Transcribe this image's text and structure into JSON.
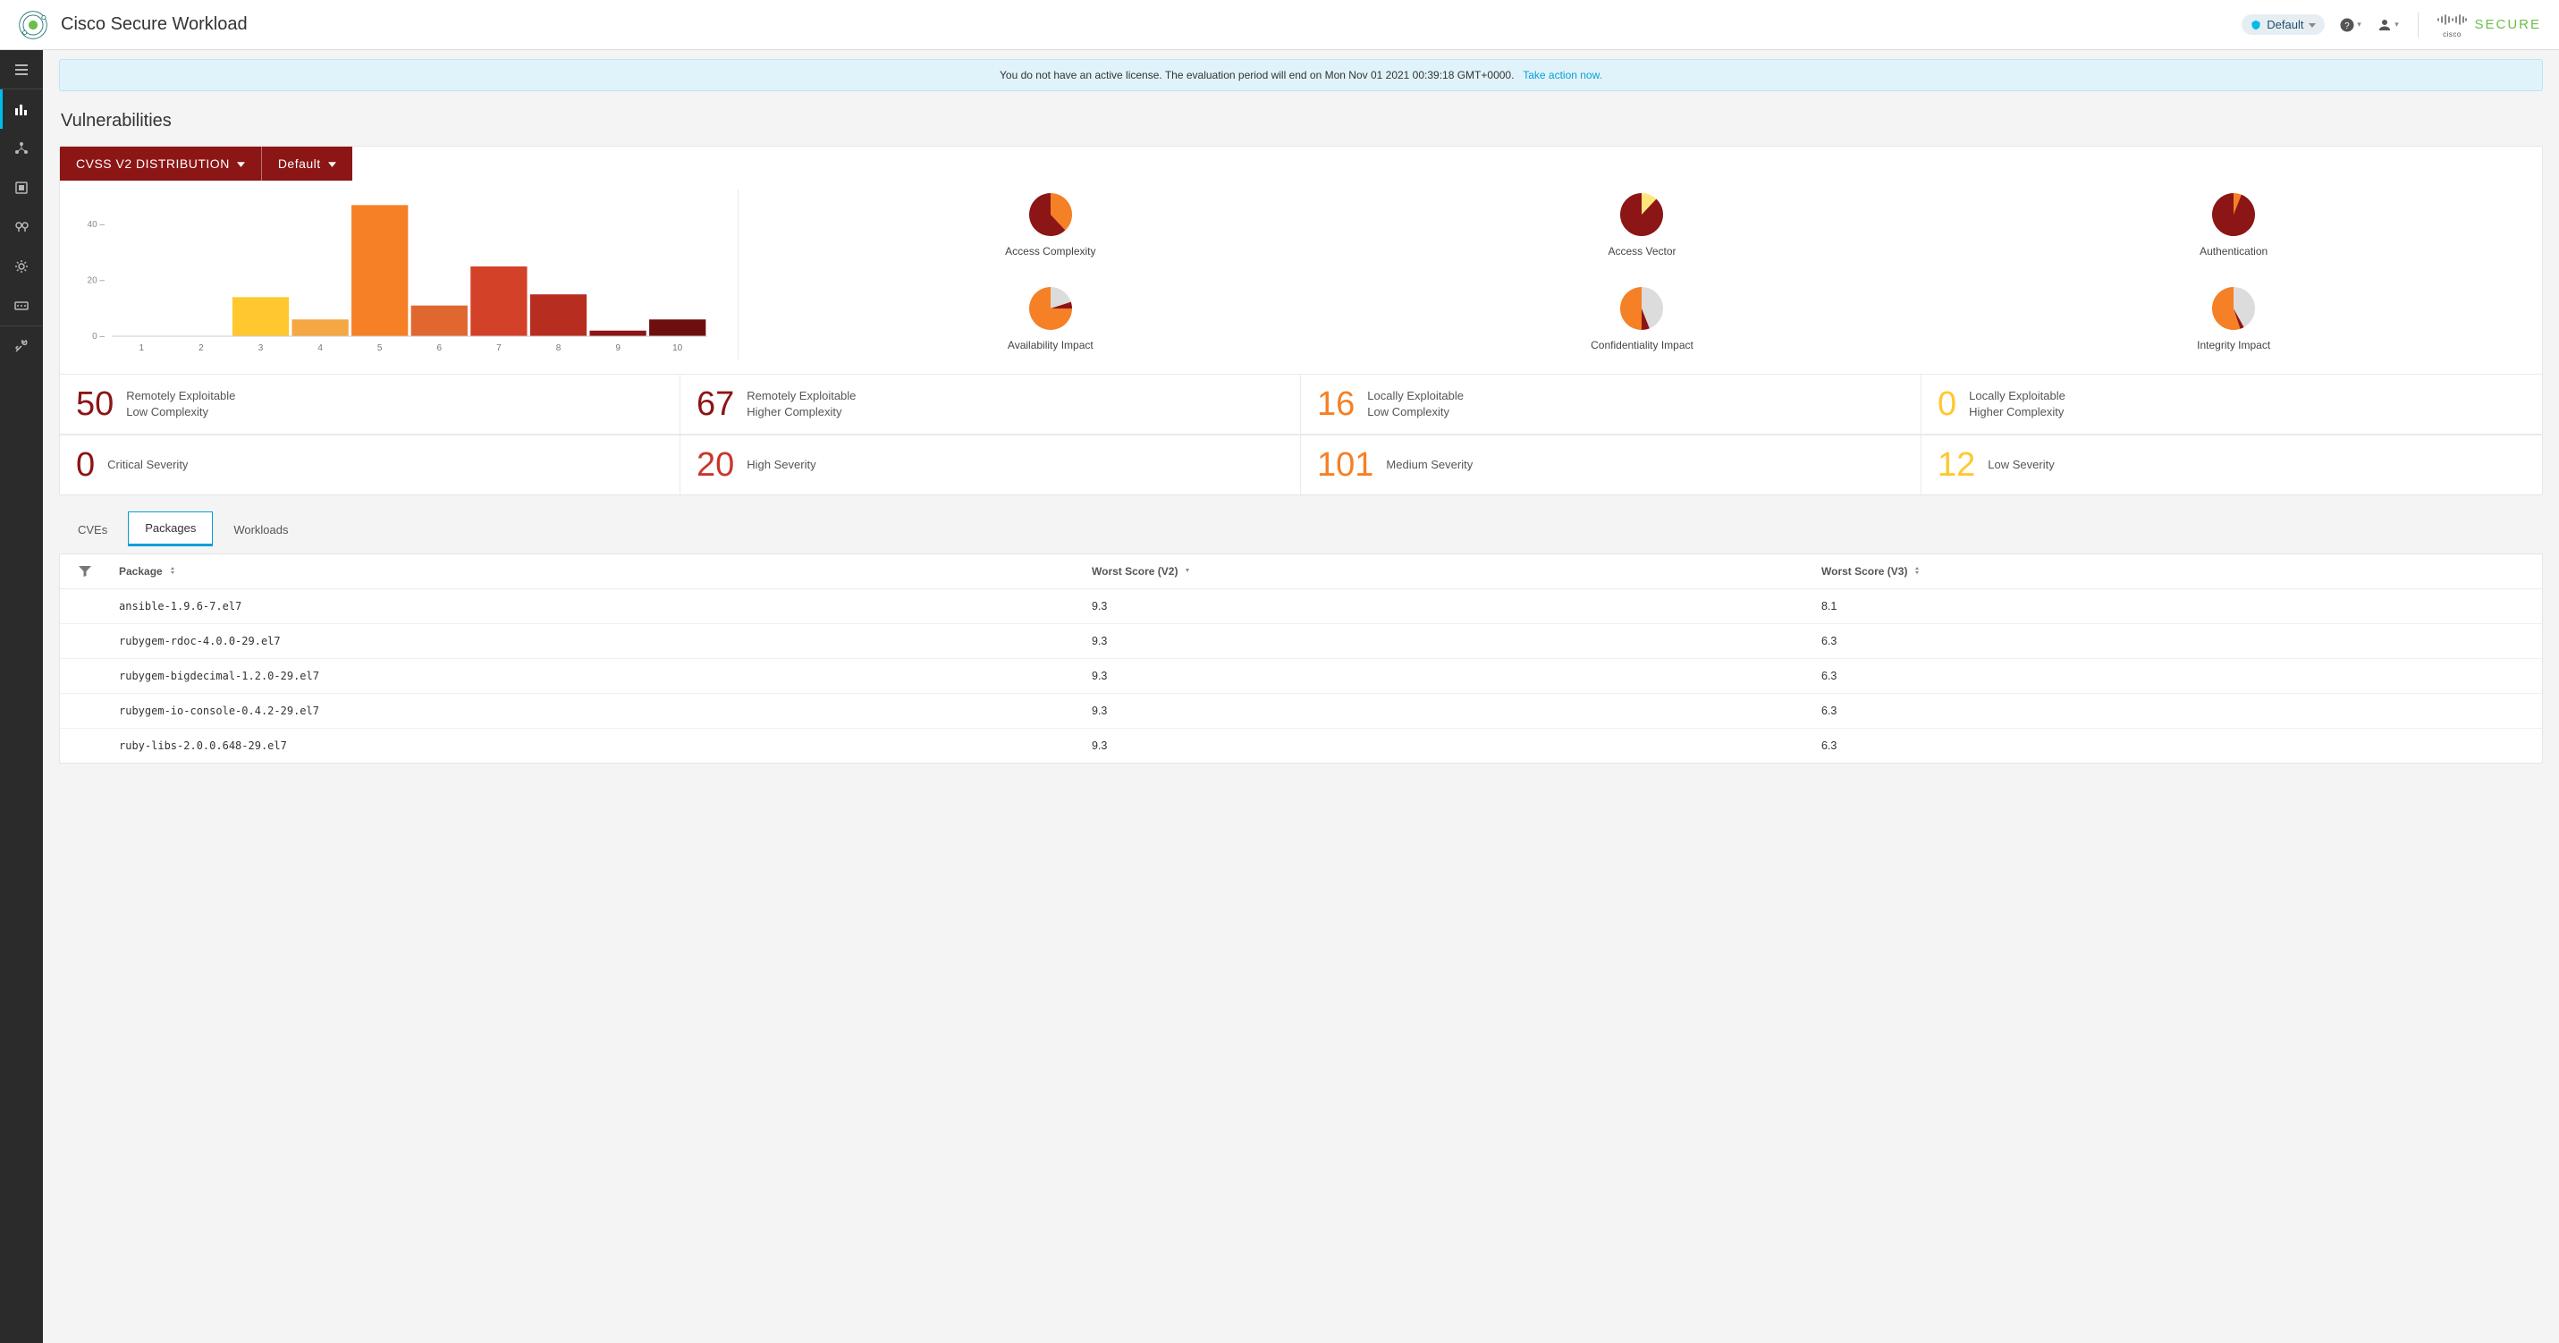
{
  "header": {
    "app_title": "Cisco Secure Workload",
    "scope_label": "Default",
    "brand": {
      "cisco": "cisco",
      "secure": "SECURE"
    }
  },
  "banner": {
    "text": "You do not have an active license. The evaluation period will end on Mon Nov 01 2021 00:39:18 GMT+0000.",
    "link": "Take action now."
  },
  "page_title": "Vulnerabilities",
  "distribution_controls": {
    "metric_label": "CVSS V2 DISTRIBUTION",
    "scope_label": "Default"
  },
  "chart_data": {
    "type": "bar",
    "xlabel": "",
    "ylabel": "",
    "ylim": [
      0,
      50
    ],
    "yticks": [
      0,
      20,
      40
    ],
    "categories": [
      1,
      2,
      3,
      4,
      5,
      6,
      7,
      8,
      9,
      10
    ],
    "values": [
      0,
      0,
      14,
      6,
      47,
      11,
      25,
      15,
      2,
      6
    ],
    "bar_colors": [
      "#ffdf5e",
      "#ffdf5e",
      "#ffc82e",
      "#f4a742",
      "#f58025",
      "#e0672f",
      "#d34129",
      "#b72e20",
      "#8c1515",
      "#6e0f0f"
    ]
  },
  "pies": [
    {
      "label": "Access Complexity",
      "slices": [
        {
          "value": 38,
          "color": "#f58025"
        },
        {
          "value": 62,
          "color": "#8c1515"
        }
      ]
    },
    {
      "label": "Access Vector",
      "slices": [
        {
          "value": 12,
          "color": "#ffe57a"
        },
        {
          "value": 88,
          "color": "#8c1515"
        }
      ]
    },
    {
      "label": "Authentication",
      "slices": [
        {
          "value": 6,
          "color": "#f58025"
        },
        {
          "value": 94,
          "color": "#8c1515"
        }
      ]
    },
    {
      "label": "Availability Impact",
      "slices": [
        {
          "value": 20,
          "color": "#dcdcdc"
        },
        {
          "value": 5,
          "color": "#8c1515"
        },
        {
          "value": 75,
          "color": "#f58025"
        }
      ]
    },
    {
      "label": "Confidentiality Impact",
      "slices": [
        {
          "value": 44,
          "color": "#dcdcdc"
        },
        {
          "value": 6,
          "color": "#8c1515"
        },
        {
          "value": 50,
          "color": "#f58025"
        }
      ]
    },
    {
      "label": "Integrity Impact",
      "slices": [
        {
          "value": 42,
          "color": "#dcdcdc"
        },
        {
          "value": 3,
          "color": "#8c1515"
        },
        {
          "value": 55,
          "color": "#f58025"
        }
      ]
    }
  ],
  "stats_row1": [
    {
      "value": "50",
      "label_line1": "Remotely Exploitable",
      "label_line2": "Low Complexity",
      "color": "c-darkred"
    },
    {
      "value": "67",
      "label_line1": "Remotely Exploitable",
      "label_line2": "Higher Complexity",
      "color": "c-darkred"
    },
    {
      "value": "16",
      "label_line1": "Locally Exploitable",
      "label_line2": "Low Complexity",
      "color": "c-orange"
    },
    {
      "value": "0",
      "label_line1": "Locally Exploitable",
      "label_line2": "Higher Complexity",
      "color": "c-yellow"
    }
  ],
  "stats_row2": [
    {
      "value": "0",
      "label_line1": "Critical Severity",
      "label_line2": "",
      "color": "c-darkred"
    },
    {
      "value": "20",
      "label_line1": "High Severity",
      "label_line2": "",
      "color": "c-red"
    },
    {
      "value": "101",
      "label_line1": "Medium Severity",
      "label_line2": "",
      "color": "c-orange"
    },
    {
      "value": "12",
      "label_line1": "Low Severity",
      "label_line2": "",
      "color": "c-yellow"
    }
  ],
  "tabs": [
    {
      "label": "CVEs",
      "active": false
    },
    {
      "label": "Packages",
      "active": true
    },
    {
      "label": "Workloads",
      "active": false
    }
  ],
  "table": {
    "columns": {
      "package": "Package",
      "v2": "Worst Score (V2)",
      "v3": "Worst Score (V3)"
    },
    "rows": [
      {
        "package": "ansible-1.9.6-7.el7",
        "v2": "9.3",
        "v3": "8.1"
      },
      {
        "package": "rubygem-rdoc-4.0.0-29.el7",
        "v2": "9.3",
        "v3": "6.3"
      },
      {
        "package": "rubygem-bigdecimal-1.2.0-29.el7",
        "v2": "9.3",
        "v3": "6.3"
      },
      {
        "package": "rubygem-io-console-0.4.2-29.el7",
        "v2": "9.3",
        "v3": "6.3"
      },
      {
        "package": "ruby-libs-2.0.0.648-29.el7",
        "v2": "9.3",
        "v3": "6.3"
      }
    ]
  }
}
